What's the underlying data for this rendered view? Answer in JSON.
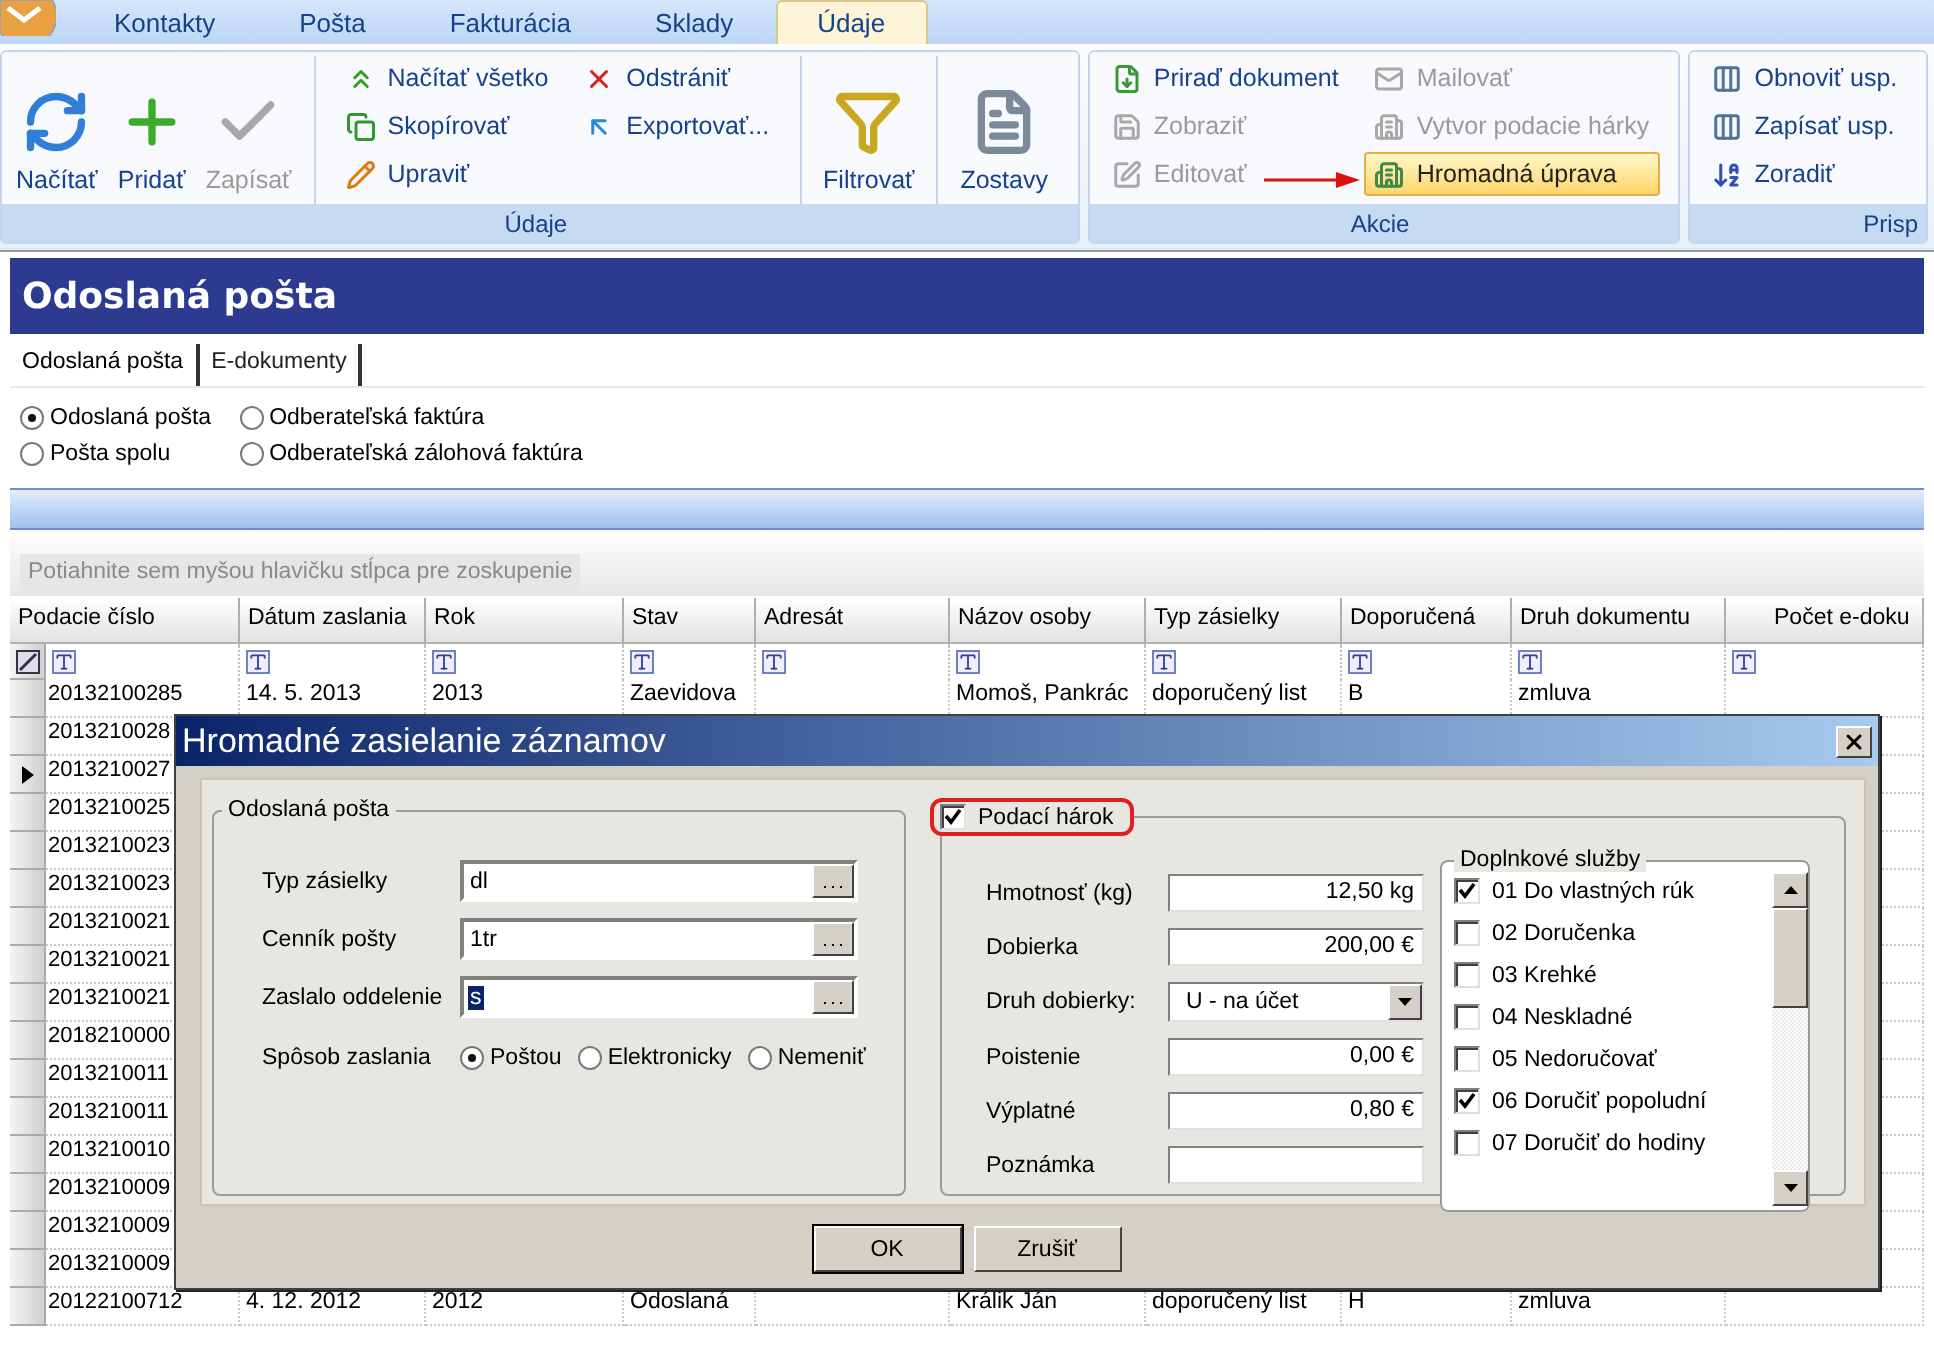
{
  "ribbon": {
    "tabs": [
      {
        "label": "Kontakty",
        "selected": false
      },
      {
        "label": "Pošta",
        "selected": false
      },
      {
        "label": "Fakturácia",
        "selected": false
      },
      {
        "label": "Sklady",
        "selected": false
      },
      {
        "label": "Údaje",
        "selected": true
      }
    ],
    "groups": [
      {
        "label": "Údaje",
        "sections": [
          [
            {
              "kind": "large",
              "items": [
                {
                  "label": "Načítať",
                  "disabled": false,
                  "highlighted": false
                }
              ]
            },
            {
              "kind": "large",
              "items": [
                {
                  "label": "Pridať",
                  "disabled": false,
                  "highlighted": false
                }
              ]
            },
            {
              "kind": "large",
              "items": [
                {
                  "label": "Zapísať",
                  "disabled": true,
                  "highlighted": false
                }
              ]
            }
          ],
          [
            {
              "kind": "small",
              "items": [
                {
                  "label": "Načítať všetko",
                  "disabled": false,
                  "highlighted": false
                },
                {
                  "label": "Skopírovať",
                  "disabled": false,
                  "highlighted": false
                },
                {
                  "label": "Upraviť",
                  "disabled": false,
                  "highlighted": false
                }
              ]
            },
            {
              "kind": "small",
              "items": [
                {
                  "label": "Odstrániť",
                  "disabled": false,
                  "highlighted": false
                },
                {
                  "label": "Exportovať...",
                  "disabled": false,
                  "highlighted": false
                }
              ]
            }
          ],
          [
            {
              "kind": "large",
              "items": [
                {
                  "label": "Filtrovať",
                  "disabled": false,
                  "highlighted": false
                }
              ]
            }
          ],
          [
            {
              "kind": "large",
              "items": [
                {
                  "label": "Zostavy",
                  "disabled": false,
                  "highlighted": false
                }
              ]
            }
          ]
        ]
      },
      {
        "label": "Akcie",
        "sections": [
          [
            {
              "kind": "small",
              "items": [
                {
                  "label": "Priraď dokument",
                  "disabled": false,
                  "highlighted": false
                },
                {
                  "label": "Zobraziť",
                  "disabled": true,
                  "highlighted": false
                },
                {
                  "label": "Editovať",
                  "disabled": true,
                  "highlighted": false
                }
              ]
            },
            {
              "kind": "small",
              "items": [
                {
                  "label": "Mailovať",
                  "disabled": true,
                  "highlighted": false
                },
                {
                  "label": "Vytvor podacie hárky",
                  "disabled": true,
                  "highlighted": false
                },
                {
                  "label": "Hromadná úprava",
                  "disabled": false,
                  "highlighted": true
                }
              ]
            }
          ]
        ]
      },
      {
        "label": "Prisp",
        "sections": [
          [
            {
              "kind": "small",
              "items": [
                {
                  "label": "Obnoviť usp.",
                  "disabled": false,
                  "highlighted": false
                },
                {
                  "label": "Zapísať usp.",
                  "disabled": false,
                  "highlighted": false
                },
                {
                  "label": "Zoradiť",
                  "disabled": false,
                  "highlighted": false
                }
              ]
            }
          ]
        ]
      }
    ]
  },
  "page_title": "Odoslaná pošta",
  "doc_tabs": [
    {
      "label": "Odoslaná pošta",
      "selected": true
    },
    {
      "label": "E-dokumenty",
      "selected": false
    }
  ],
  "filter_options": [
    {
      "label": "Odoslaná pošta",
      "selected": true
    },
    {
      "label": "Pošta spolu",
      "selected": false
    },
    {
      "label": "Odberateľská faktúra",
      "selected": false
    },
    {
      "label": "Odberateľská zálohová faktúra",
      "selected": false
    }
  ],
  "group_panel": {
    "hint": "Potiahnite sem myšou hlavičku stĺpca pre zoskupenie"
  },
  "grid": {
    "columns": [
      "Podacie číslo",
      "Dátum zaslania",
      "Rok",
      "Stav",
      "Adresát",
      "Názov osoby",
      "Typ zásielky",
      "Doporučená",
      "Druh dokumentu",
      "Počet e-doku"
    ],
    "rows": [
      {
        "current": false,
        "cells": [
          "20132100285",
          "14. 5. 2013",
          "2013",
          "Zaevidova",
          null,
          "Momoš, Pankrác",
          "doporučený list",
          "B",
          "zmluva"
        ]
      },
      {
        "current": false,
        "cells": [
          "2013210028"
        ]
      },
      {
        "current": true,
        "cells": [
          "2013210027"
        ]
      },
      {
        "current": false,
        "cells": [
          "2013210025"
        ]
      },
      {
        "current": false,
        "cells": [
          "2013210023"
        ]
      },
      {
        "current": false,
        "cells": [
          "2013210023"
        ]
      },
      {
        "current": false,
        "cells": [
          "2013210021"
        ]
      },
      {
        "current": false,
        "cells": [
          "2013210021"
        ]
      },
      {
        "current": false,
        "cells": [
          "2013210021"
        ]
      },
      {
        "current": false,
        "cells": [
          "2018210000"
        ]
      },
      {
        "current": false,
        "cells": [
          "2013210011"
        ]
      },
      {
        "current": false,
        "cells": [
          "2013210011"
        ]
      },
      {
        "current": false,
        "cells": [
          "2013210010"
        ]
      },
      {
        "current": false,
        "cells": [
          "2013210009"
        ]
      },
      {
        "current": false,
        "cells": [
          "2013210009"
        ]
      },
      {
        "current": false,
        "cells": [
          "2013210009"
        ]
      },
      {
        "current": false,
        "cells": [
          "20122100712",
          "4. 12. 2012",
          "2012",
          "Odoslaná",
          null,
          "Králik Ján",
          "doporučený list",
          "H",
          "zmluva"
        ]
      }
    ]
  },
  "dialog": {
    "title": "Hromadné zasielanie záznamov",
    "left_group": {
      "title": "Odoslaná pošta",
      "fields": [
        {
          "label": "Typ zásielky",
          "value": "dl",
          "text_selected": false
        },
        {
          "label": "Cenník pošty",
          "value": "1tr",
          "text_selected": false
        },
        {
          "label": "Zaslalo oddelenie",
          "value": "s",
          "text_selected": true
        }
      ],
      "send_method": {
        "label": "Spôsob zaslania",
        "options": [
          {
            "label": "Poštou",
            "selected": true
          },
          {
            "label": "Elektronicky",
            "selected": false
          },
          {
            "label": "Nemeniť",
            "selected": false
          }
        ]
      }
    },
    "right_group": {
      "title": "Podací hárok",
      "checked": true,
      "fields": [
        {
          "kind": "text",
          "label": "Hmotnosť (kg)",
          "value": "12,50 kg"
        },
        {
          "kind": "text",
          "label": "Dobierka",
          "value": "200,00 €"
        },
        {
          "kind": "dropdown",
          "label": "Druh dobierky:",
          "value": "U - na účet"
        },
        {
          "kind": "text",
          "label": "Poistenie",
          "value": "0,00 €"
        },
        {
          "kind": "text",
          "label": "Výplatné",
          "value": "0,80 €"
        },
        {
          "kind": "text",
          "label": "Poznámka"
        }
      ],
      "services": {
        "title": "Doplnkové služby",
        "items": [
          {
            "label": "01 Do vlastných rúk",
            "checked": true
          },
          {
            "label": "02 Doručenka",
            "checked": false
          },
          {
            "label": "03 Krehké",
            "checked": false
          },
          {
            "label": "04 Neskladné",
            "checked": false
          },
          {
            "label": "05 Nedoručovať",
            "checked": false
          },
          {
            "label": "06 Doručiť popoludní",
            "checked": true
          },
          {
            "label": "07 Doručiť do hodiny",
            "checked": false
          }
        ]
      }
    },
    "buttons": [
      {
        "label": "OK",
        "default": true
      },
      {
        "label": "Zrušiť",
        "default": false
      }
    ]
  }
}
